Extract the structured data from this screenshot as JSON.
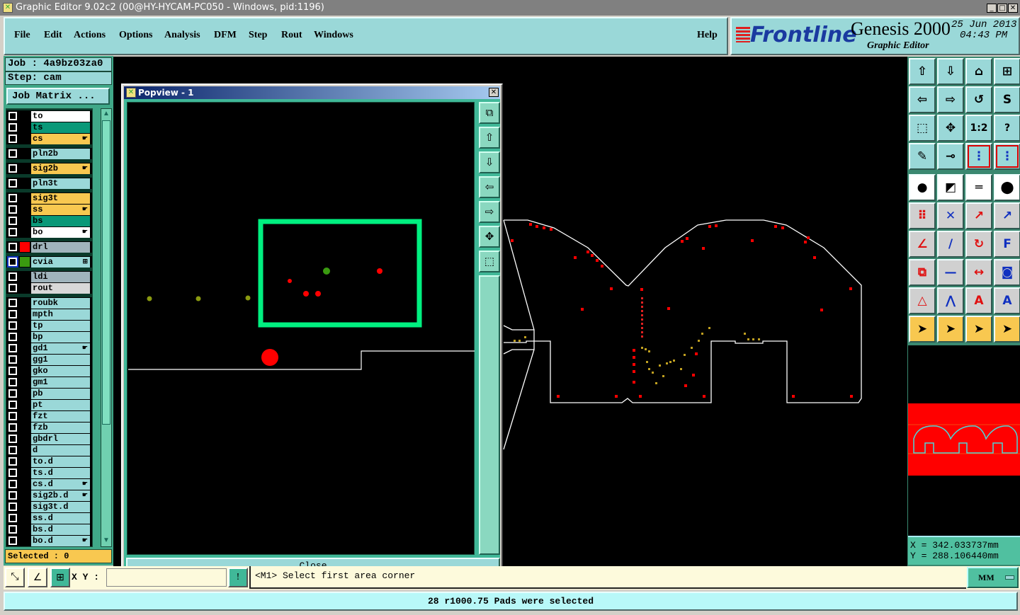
{
  "window": {
    "title": "Graphic Editor 9.02c2 (00@HY-HYCAM-PC050 - Windows, pid:1196)",
    "minimize": "_",
    "maximize": "□",
    "close": "✕"
  },
  "menu": {
    "items": [
      "File",
      "Edit",
      "Actions",
      "Options",
      "Analysis",
      "DFM",
      "Step",
      "Rout",
      "Windows"
    ],
    "help": "Help"
  },
  "brand": {
    "logo": "Frontline",
    "product": "Genesis 2000",
    "subtitle": "Graphic Editor",
    "date": "25 Jun 2013",
    "time": "04:43 PM"
  },
  "job": {
    "job_label": "Job : 4a9bz03za0",
    "step_label": "Step: cam",
    "matrix_button": "Job Matrix ...",
    "selected": "Selected : 0"
  },
  "layers": [
    [
      {
        "name": "to",
        "color": "#ffffff"
      },
      {
        "name": "ts",
        "color": "#0a9878"
      },
      {
        "name": "cs",
        "color": "#f8c850",
        "hand": true
      }
    ],
    [
      {
        "name": "pln2b",
        "color": "#9ad8d8"
      }
    ],
    [
      {
        "name": "sig2b",
        "color": "#f8c850",
        "hand": true
      }
    ],
    [
      {
        "name": "pln3t",
        "color": "#9ad8d8"
      }
    ],
    [
      {
        "name": "sig3t",
        "color": "#f8c850"
      },
      {
        "name": "ss",
        "color": "#f8c850",
        "hand": true
      },
      {
        "name": "bs",
        "color": "#0a9878"
      },
      {
        "name": "bo",
        "color": "#ffffff",
        "hand": true
      }
    ],
    [
      {
        "name": "drl",
        "color": "#a0b4bc",
        "swatch": "#ff0000"
      }
    ],
    [
      {
        "name": "cvia",
        "color": "#9ad8d8",
        "swatch": "#3a9a10",
        "active": true,
        "mark": "⊞"
      }
    ],
    [
      {
        "name": "ldi",
        "color": "#a0b4bc"
      },
      {
        "name": "rout",
        "color": "#d8d8d8"
      }
    ],
    [
      {
        "name": "roubk",
        "color": "#9ad8d8"
      },
      {
        "name": "mpth",
        "color": "#9ad8d8"
      },
      {
        "name": "tp",
        "color": "#9ad8d8"
      },
      {
        "name": "bp",
        "color": "#9ad8d8"
      },
      {
        "name": "gd1",
        "color": "#9ad8d8",
        "hand": true
      },
      {
        "name": "gg1",
        "color": "#9ad8d8"
      },
      {
        "name": "gko",
        "color": "#9ad8d8"
      },
      {
        "name": "gm1",
        "color": "#9ad8d8"
      },
      {
        "name": "pb",
        "color": "#9ad8d8"
      },
      {
        "name": "pt",
        "color": "#9ad8d8"
      },
      {
        "name": "fzt",
        "color": "#9ad8d8"
      },
      {
        "name": "fzb",
        "color": "#9ad8d8"
      },
      {
        "name": "gbdrl",
        "color": "#9ad8d8"
      },
      {
        "name": "d",
        "color": "#9ad8d8"
      },
      {
        "name": "to.d",
        "color": "#9ad8d8"
      },
      {
        "name": "ts.d",
        "color": "#9ad8d8"
      },
      {
        "name": "cs.d",
        "color": "#9ad8d8",
        "hand": true
      },
      {
        "name": "sig2b.d",
        "color": "#9ad8d8",
        "hand": true
      },
      {
        "name": "sig3t.d",
        "color": "#9ad8d8"
      },
      {
        "name": "ss.d",
        "color": "#9ad8d8"
      },
      {
        "name": "bs.d",
        "color": "#9ad8d8"
      },
      {
        "name": "bo.d",
        "color": "#9ad8d8",
        "hand": true
      }
    ]
  ],
  "popview": {
    "title": "Popview - 1",
    "close_label": "Close",
    "tools": [
      "zoom-back-icon",
      "pan-up-icon",
      "pan-down-icon",
      "pan-left-icon",
      "pan-right-icon",
      "zoom-in-icon",
      "zoom-out-icon"
    ]
  },
  "toolbar": [
    {
      "icon": "pan-up-icon",
      "g": "⇧"
    },
    {
      "icon": "pan-down-icon",
      "g": "⇩"
    },
    {
      "icon": "home-icon",
      "g": "⌂"
    },
    {
      "icon": "xy-grid-icon",
      "g": "⊞"
    },
    {
      "icon": "pan-left-icon",
      "g": "⇦"
    },
    {
      "icon": "pan-right-icon",
      "g": "⇨"
    },
    {
      "icon": "undo-view-icon",
      "g": "↺"
    },
    {
      "icon": "snake-icon",
      "g": "S"
    },
    {
      "icon": "zoom-out-icon",
      "g": "⬚"
    },
    {
      "icon": "zoom-in-icon",
      "g": "✥"
    },
    {
      "icon": "scale-icon",
      "g": "1:2"
    },
    {
      "icon": "help-icon",
      "g": "?"
    },
    {
      "icon": "tools-palette-icon",
      "g": "✎"
    },
    {
      "icon": "snap-icon",
      "g": "⊸"
    },
    {
      "icon": "netlist-icon",
      "g": "⋮",
      "red": true
    },
    {
      "icon": "netlist-alt-icon",
      "g": "⋮",
      "red": true
    },
    {
      "icon": "add-pad-icon",
      "g": "●",
      "white": true
    },
    {
      "icon": "add-line-icon",
      "g": "◩",
      "white": true
    },
    {
      "icon": "measure-icon",
      "g": "═",
      "white": true
    },
    {
      "icon": "pad-dashed-icon",
      "g": "⬤",
      "white": true
    },
    {
      "icon": "connect-icon",
      "g": "⠿"
    },
    {
      "icon": "delete-icon",
      "g": "✕"
    },
    {
      "icon": "move-pad-icon",
      "g": "↗"
    },
    {
      "icon": "copy-pad-icon",
      "g": "↗"
    },
    {
      "icon": "angle-icon",
      "g": "∠"
    },
    {
      "icon": "move-line-icon",
      "g": "/"
    },
    {
      "icon": "rotate-icon",
      "g": "↻"
    },
    {
      "icon": "mirror-icon",
      "g": "F"
    },
    {
      "icon": "resize-icon",
      "g": "⧉"
    },
    {
      "icon": "line-break-icon",
      "g": "—"
    },
    {
      "icon": "stretch-icon",
      "g": "↔"
    },
    {
      "icon": "shape-icon",
      "g": "◙"
    },
    {
      "icon": "arc-icon",
      "g": "△"
    },
    {
      "icon": "arc-double-icon",
      "g": "⋀"
    },
    {
      "icon": "arc-flat-icon",
      "g": "A"
    },
    {
      "icon": "arc-cross-icon",
      "g": "A"
    },
    {
      "icon": "select-icon",
      "g": "➤",
      "yellow": true
    },
    {
      "icon": "select-box-icon",
      "g": "➤",
      "yellow": true
    },
    {
      "icon": "select-poly-icon",
      "g": "➤",
      "yellow": true
    },
    {
      "icon": "select-net-icon",
      "g": "➤",
      "yellow": true
    }
  ],
  "coords": {
    "x": "X  = 342.033737mm",
    "y": "Y  = 288.106440mm"
  },
  "bottombar": {
    "xy_label": "X Y :",
    "xy_value": "",
    "message": "<M1>  Select first area corner",
    "units": "MM"
  },
  "status": "28 r1000.75 Pads were selected"
}
